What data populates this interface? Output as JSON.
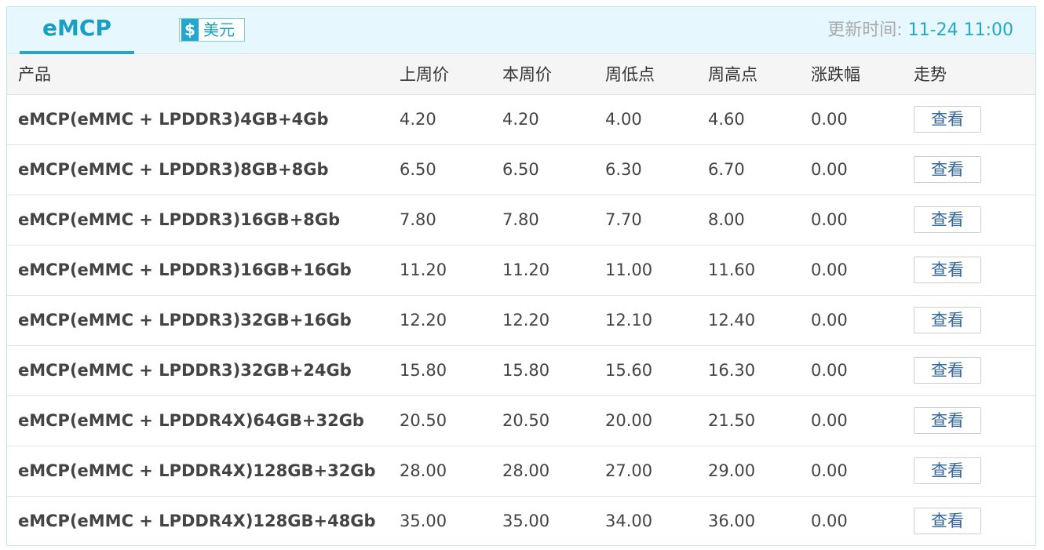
{
  "header": {
    "tab_label": "eMCP",
    "currency_icon": "$",
    "currency_label": "美元",
    "update_label": "更新时间: ",
    "update_value": "11-24 11:00"
  },
  "table": {
    "columns": [
      "产品",
      "上周价",
      "本周价",
      "周低点",
      "周高点",
      "涨跌幅",
      "走势"
    ],
    "view_label": "查看",
    "rows": [
      {
        "name": "eMCP(eMMC + LPDDR3)4GB+4Gb",
        "last": "4.20",
        "this": "4.20",
        "low": "4.00",
        "high": "4.60",
        "change": "0.00"
      },
      {
        "name": "eMCP(eMMC + LPDDR3)8GB+8Gb",
        "last": "6.50",
        "this": "6.50",
        "low": "6.30",
        "high": "6.70",
        "change": "0.00"
      },
      {
        "name": "eMCP(eMMC + LPDDR3)16GB+8Gb",
        "last": "7.80",
        "this": "7.80",
        "low": "7.70",
        "high": "8.00",
        "change": "0.00"
      },
      {
        "name": "eMCP(eMMC + LPDDR3)16GB+16Gb",
        "last": "11.20",
        "this": "11.20",
        "low": "11.00",
        "high": "11.60",
        "change": "0.00"
      },
      {
        "name": "eMCP(eMMC + LPDDR3)32GB+16Gb",
        "last": "12.20",
        "this": "12.20",
        "low": "12.10",
        "high": "12.40",
        "change": "0.00"
      },
      {
        "name": "eMCP(eMMC + LPDDR3)32GB+24Gb",
        "last": "15.80",
        "this": "15.80",
        "low": "15.60",
        "high": "16.30",
        "change": "0.00"
      },
      {
        "name": "eMCP(eMMC + LPDDR4X)64GB+32Gb",
        "last": "20.50",
        "this": "20.50",
        "low": "20.00",
        "high": "21.50",
        "change": "0.00"
      },
      {
        "name": "eMCP(eMMC + LPDDR4X)128GB+32Gb",
        "last": "28.00",
        "this": "28.00",
        "low": "27.00",
        "high": "29.00",
        "change": "0.00"
      },
      {
        "name": "eMCP(eMMC + LPDDR4X)128GB+48Gb",
        "last": "35.00",
        "this": "35.00",
        "low": "34.00",
        "high": "36.00",
        "change": "0.00"
      }
    ]
  }
}
